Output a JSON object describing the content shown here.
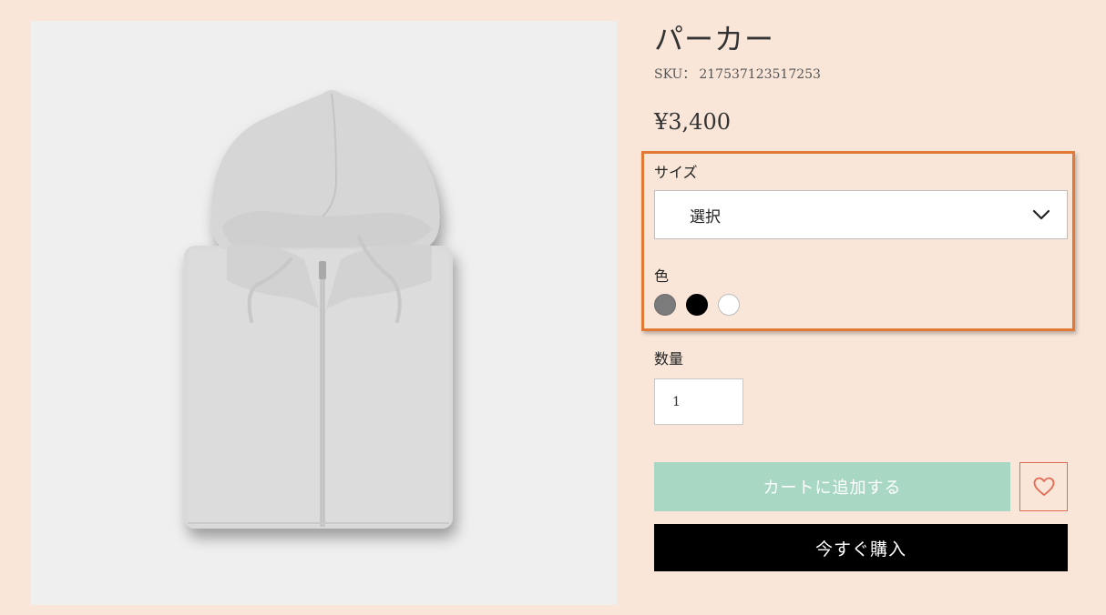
{
  "product": {
    "title": "パーカー",
    "sku_label": "SKU：",
    "sku_value": "217537123517253",
    "price": "¥3,400",
    "image_icon": "hoodie-image"
  },
  "size": {
    "label": "サイズ",
    "selected": "選択",
    "icon": "chevron-down-icon"
  },
  "color": {
    "label": "色",
    "swatches": [
      "#7b7b7b",
      "#000000",
      "#ffffff"
    ]
  },
  "quantity": {
    "label": "数量",
    "value": "1"
  },
  "actions": {
    "add_to_cart": "カートに追加する",
    "buy_now": "今すぐ購入",
    "wishlist_icon": "heart-icon"
  },
  "colors": {
    "background": "#f9e6d9",
    "highlight": "#e07a36",
    "add_to_cart_bg": "#a8d8c4",
    "buy_now_bg": "#000000",
    "wishlist_border": "#e36a52"
  }
}
